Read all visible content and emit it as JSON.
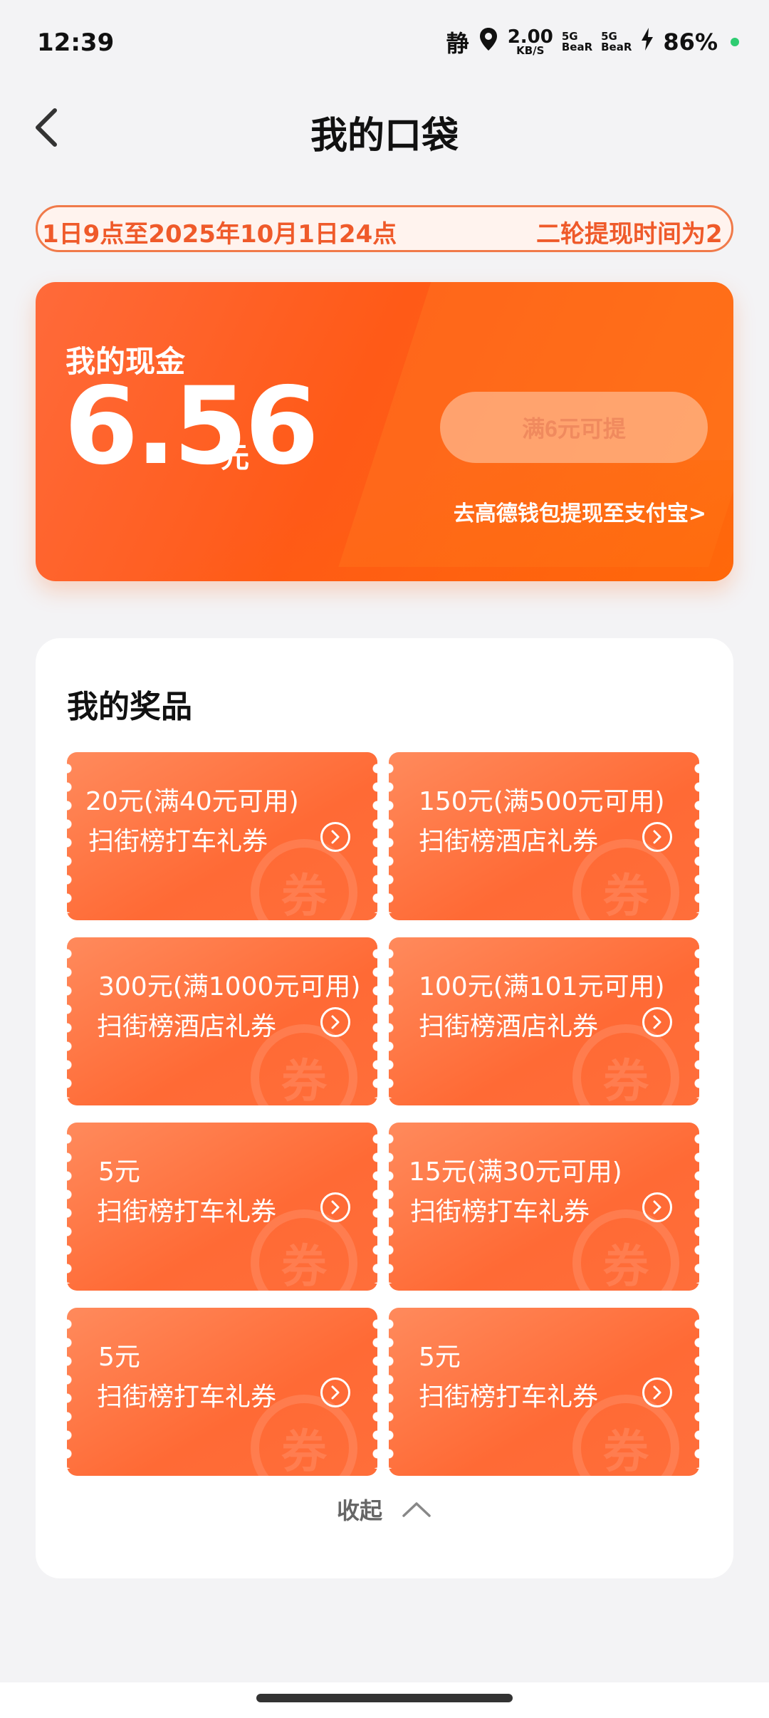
{
  "status_bar": {
    "time": "12:39",
    "mute_label": "静",
    "speed_value": "2.00",
    "speed_unit": "KB/S",
    "sim1_gen": "5G",
    "sim1_carrier": "BeaR",
    "sim2_gen": "5G",
    "sim2_carrier": "BeaR",
    "battery": "86%"
  },
  "nav": {
    "title": "我的口袋"
  },
  "banner": {
    "text_left": "1日9点至2025年10月1日24点",
    "text_right": "二轮提现时间为2"
  },
  "cash": {
    "label": "我的现金",
    "amount": "6.56",
    "unit": "元",
    "withdraw_button": "满6元可提",
    "wallet_link": "去高德钱包提现至支付宝>"
  },
  "prizes": {
    "title": "我的奖品",
    "watermark": "券",
    "coupons": [
      {
        "amount": "20元(满40元可用)",
        "name": "扫街榜打车礼券"
      },
      {
        "amount": "150元(满500元可用)",
        "name": "扫街榜酒店礼券"
      },
      {
        "amount": "300元(满1000元可用)",
        "name": "扫街榜酒店礼券"
      },
      {
        "amount": "100元(满101元可用)",
        "name": "扫街榜酒店礼券"
      },
      {
        "amount": "5元",
        "name": "扫街榜打车礼券"
      },
      {
        "amount": "15元(满30元可用)",
        "name": "扫街榜打车礼券"
      },
      {
        "amount": "5元",
        "name": "扫街榜打车礼券"
      },
      {
        "amount": "5元",
        "name": "扫街榜打车礼券"
      }
    ],
    "collapse_label": "收起"
  },
  "colors": {
    "accent": "#ff5a17",
    "coupon": "#ff6e3a",
    "banner_text": "#ef5a2a"
  }
}
